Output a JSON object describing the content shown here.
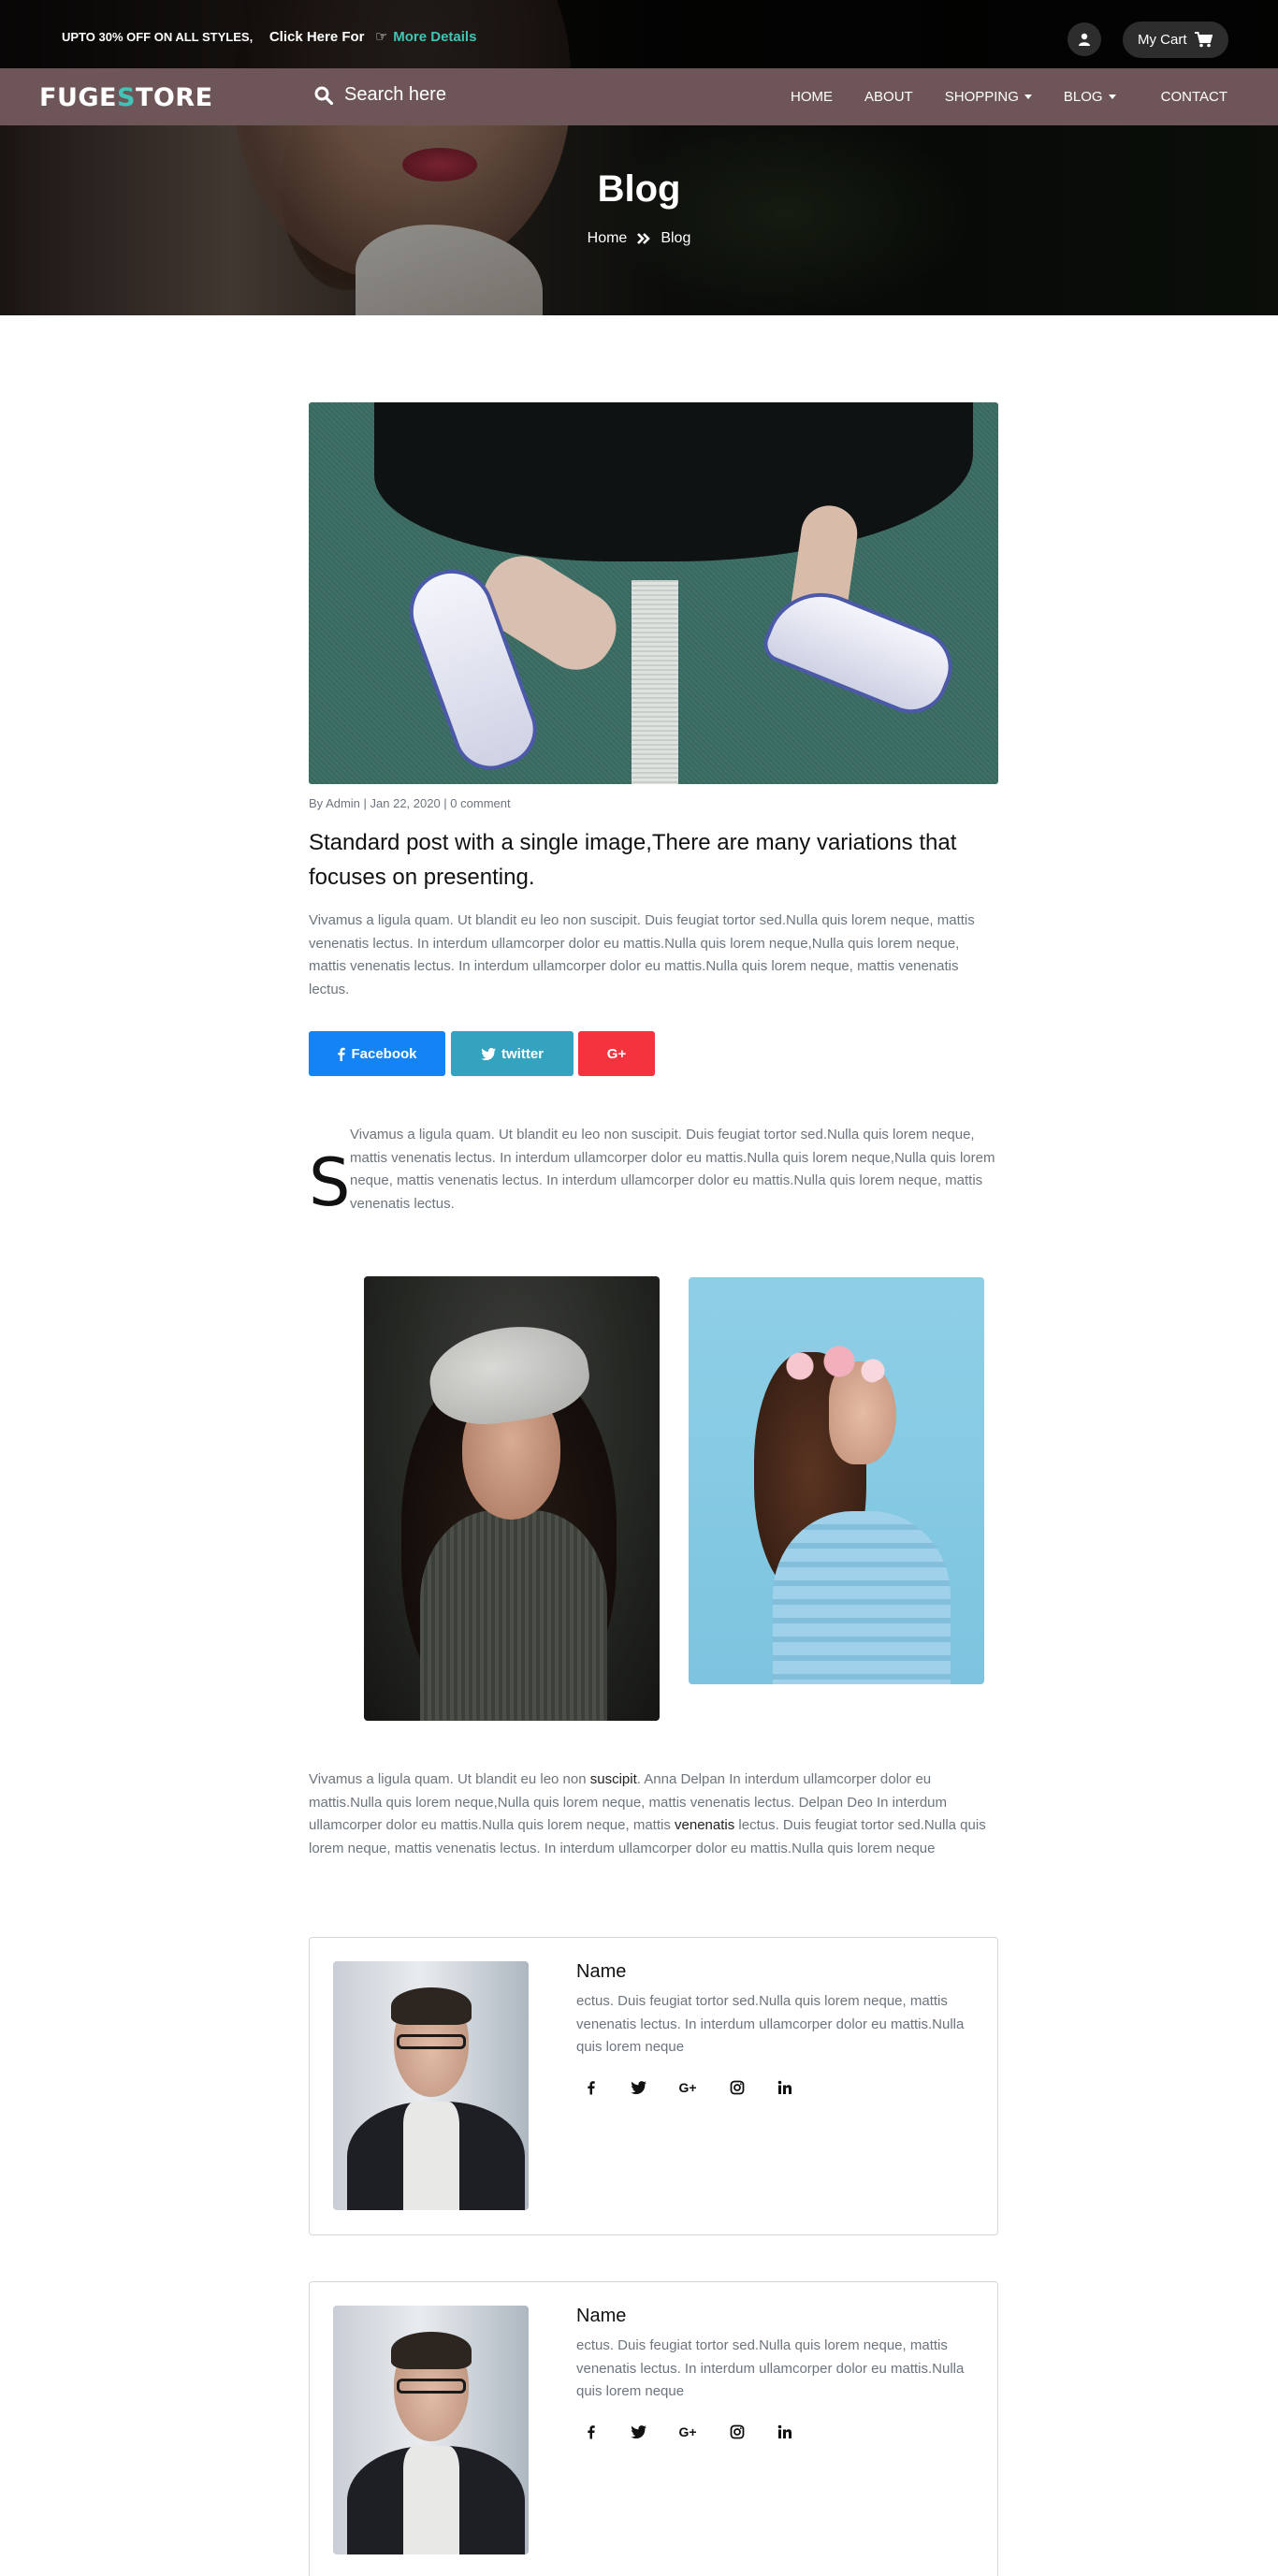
{
  "promo": {
    "offer": "UPTO 30% OFF ON ALL STYLES,",
    "click": "Click Here For",
    "more": "More Details"
  },
  "header": {
    "cart_label": "My Cart",
    "logo_prefix": "FUGE",
    "logo_s": "S",
    "logo_suffix": "TORE",
    "search_placeholder": "Search here"
  },
  "nav": {
    "home": "HOME",
    "about": "ABOUT",
    "shopping": "SHOPPING",
    "blog": "BLOG",
    "contact": "CONTACT"
  },
  "hero": {
    "title": "Blog",
    "breadcrumb_home": "Home",
    "breadcrumb_current": "Blog"
  },
  "post": {
    "meta": "By Admin | Jan 22, 2020 | 0 comment",
    "title": "Standard post with a single image,There are many variations that focuses on presenting.",
    "paragraph1": "Vivamus a ligula quam. Ut blandit eu leo non suscipit. Duis feugiat tortor sed.Nulla quis lorem neque, mattis venenatis lectus. In interdum ullamcorper dolor eu mattis.Nulla quis lorem neque,Nulla quis lorem neque, mattis venenatis lectus. In interdum ullamcorper dolor eu mattis.Nulla quis lorem neque, mattis venenatis lectus.",
    "share_facebook": "Facebook",
    "share_twitter": "twitter",
    "share_gplus": "G+",
    "dropcap": "S",
    "paragraph2": "Vivamus a ligula quam. Ut blandit eu leo non suscipit. Duis feugiat tortor sed.Nulla quis lorem neque, mattis venenatis lectus. In interdum ullamcorper dolor eu mattis.Nulla quis lorem neque,Nulla quis lorem neque, mattis venenatis lectus. In interdum ullamcorper dolor eu mattis.Nulla quis lorem neque, mattis venenatis lectus.",
    "paragraph3_a": "Vivamus a ligula quam. Ut blandit eu leo non ",
    "paragraph3_b": "suscipit",
    "paragraph3_c": ". Anna Delpan In interdum ullamcorper dolor eu mattis.Nulla quis lorem neque,Nulla quis lorem neque, mattis venenatis lectus. Delpan Deo In interdum ullamcorper dolor eu mattis.Nulla quis lorem neque, mattis ",
    "paragraph3_d": "venenatis",
    "paragraph3_e": " lectus. Duis feugiat tortor sed.Nulla quis lorem neque, mattis venenatis lectus. In interdum ullamcorper dolor eu mattis.Nulla quis lorem neque"
  },
  "authors": [
    {
      "name": "Name",
      "bio": "ectus. Duis feugiat tortor sed.Nulla quis lorem neque, mattis venenatis lectus. In interdum ullamcorper dolor eu mattis.Nulla quis lorem neque",
      "socials": [
        "facebook-icon",
        "twitter-icon",
        "google-plus-icon",
        "instagram-icon",
        "linkedin-icon"
      ]
    },
    {
      "name": "Name",
      "bio": "ectus. Duis feugiat tortor sed.Nulla quis lorem neque, mattis venenatis lectus. In interdum ullamcorper dolor eu mattis.Nulla quis lorem neque",
      "socials": [
        "facebook-icon",
        "twitter-icon",
        "google-plus-icon",
        "instagram-icon",
        "linkedin-icon"
      ]
    }
  ],
  "colors": {
    "accent_teal": "#3fc5b6",
    "navbar": "#6e5658",
    "facebook": "#1383f5",
    "twitter": "#33a3c0",
    "google_plus": "#f5333e",
    "body_text": "#6c757d"
  }
}
